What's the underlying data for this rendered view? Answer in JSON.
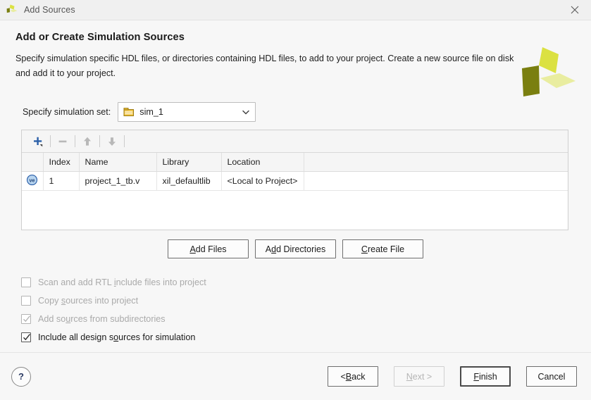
{
  "window": {
    "title": "Add Sources",
    "icon": "xilinx-logo-icon",
    "close_icon": "close-icon"
  },
  "header": {
    "title": "Add or Create Simulation Sources",
    "description": "Specify simulation specific HDL files, or directories containing HDL files, to add to your project. Create a new source file on disk and add it to your project.",
    "logo": "xilinx-logo"
  },
  "simulation_set": {
    "label": "Specify simulation set:",
    "value": "sim_1",
    "icon": "folder-icon",
    "arrow_icon": "chevron-down-icon",
    "options": [
      "sim_1"
    ]
  },
  "toolbar": {
    "add_icon": "plus-icon",
    "remove_icon": "minus-icon",
    "move_up_icon": "arrow-up-icon",
    "move_down_icon": "arrow-down-icon"
  },
  "table": {
    "columns": [
      "",
      "Index",
      "Name",
      "Library",
      "Location"
    ],
    "rows": [
      {
        "icon": "verilog-file-icon",
        "icon_text": "ve",
        "index": "1",
        "name": "project_1_tb.v",
        "library": "xil_defaultlib",
        "location": "<Local to Project>"
      }
    ]
  },
  "mid_buttons": [
    {
      "label": "Add Files",
      "mnemonic_before": "",
      "mnemonic": "A",
      "mnemonic_after": "dd Files"
    },
    {
      "label": "Add Directories",
      "mnemonic_before": "A",
      "mnemonic": "d",
      "mnemonic_after": "d Directories"
    },
    {
      "label": "Create File",
      "mnemonic_before": "",
      "mnemonic": "C",
      "mnemonic_after": "reate File"
    }
  ],
  "checkboxes": [
    {
      "label": "Scan and add RTL include files into project",
      "before": "Scan and add RTL ",
      "mnemonic": "i",
      "after": "nclude files into project",
      "checked": false,
      "enabled": false
    },
    {
      "label": "Copy sources into project",
      "before": "Copy ",
      "mnemonic": "s",
      "after": "ources into project",
      "checked": false,
      "enabled": false
    },
    {
      "label": "Add sources from subdirectories",
      "before": "Add so",
      "mnemonic": "u",
      "after": "rces from subdirectories",
      "checked": true,
      "enabled": false
    },
    {
      "label": "Include all design sources for simulation",
      "before": "Include all design s",
      "mnemonic": "o",
      "after": "urces for simulation",
      "checked": true,
      "enabled": true
    }
  ],
  "footer": {
    "help_label": "?",
    "buttons": [
      {
        "label": "< Back",
        "before": "< ",
        "mnemonic": "B",
        "after": "ack",
        "enabled": true,
        "default": false
      },
      {
        "label": "Next >",
        "before": "",
        "mnemonic": "N",
        "after": "ext >",
        "enabled": false,
        "default": false
      },
      {
        "label": "Finish",
        "before": "",
        "mnemonic": "F",
        "after": "inish",
        "enabled": true,
        "default": true
      },
      {
        "label": "Cancel",
        "before": "Cancel",
        "mnemonic": "",
        "after": "",
        "enabled": true,
        "default": false
      }
    ]
  },
  "colors": {
    "logo_dark": "#7a7f10",
    "logo_bright": "#dbe142",
    "logo_light": "#e9eda0",
    "accent_blue": "#2b5fa8",
    "dialog_bg": "#f7f7f7"
  }
}
